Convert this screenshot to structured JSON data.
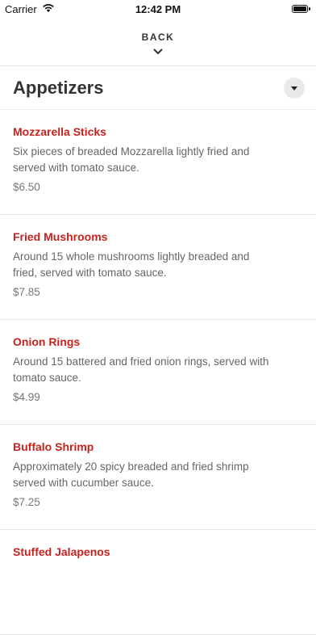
{
  "status_bar": {
    "carrier": "Carrier",
    "time": "12:42 PM"
  },
  "nav": {
    "back_label": "BACK"
  },
  "section": {
    "title": "Appetizers"
  },
  "items": [
    {
      "name": "Mozzarella Sticks",
      "description": "Six pieces of breaded Mozzarella lightly fried and served with tomato sauce.",
      "price": "$6.50"
    },
    {
      "name": "Fried Mushrooms",
      "description": "Around 15 whole mushrooms lightly breaded and fried, served with tomato sauce.",
      "price": "$7.85"
    },
    {
      "name": "Onion Rings",
      "description": "Around 15 battered and fried onion rings, served with tomato sauce.",
      "price": "$4.99"
    },
    {
      "name": "Buffalo Shrimp",
      "description": "Approximately 20 spicy breaded and fried shrimp served with cucumber sauce.",
      "price": "$7.25"
    },
    {
      "name": "Stuffed Jalapenos",
      "description": "",
      "price": ""
    }
  ],
  "colors": {
    "item_name": "#c8221e",
    "text": "#666666"
  }
}
